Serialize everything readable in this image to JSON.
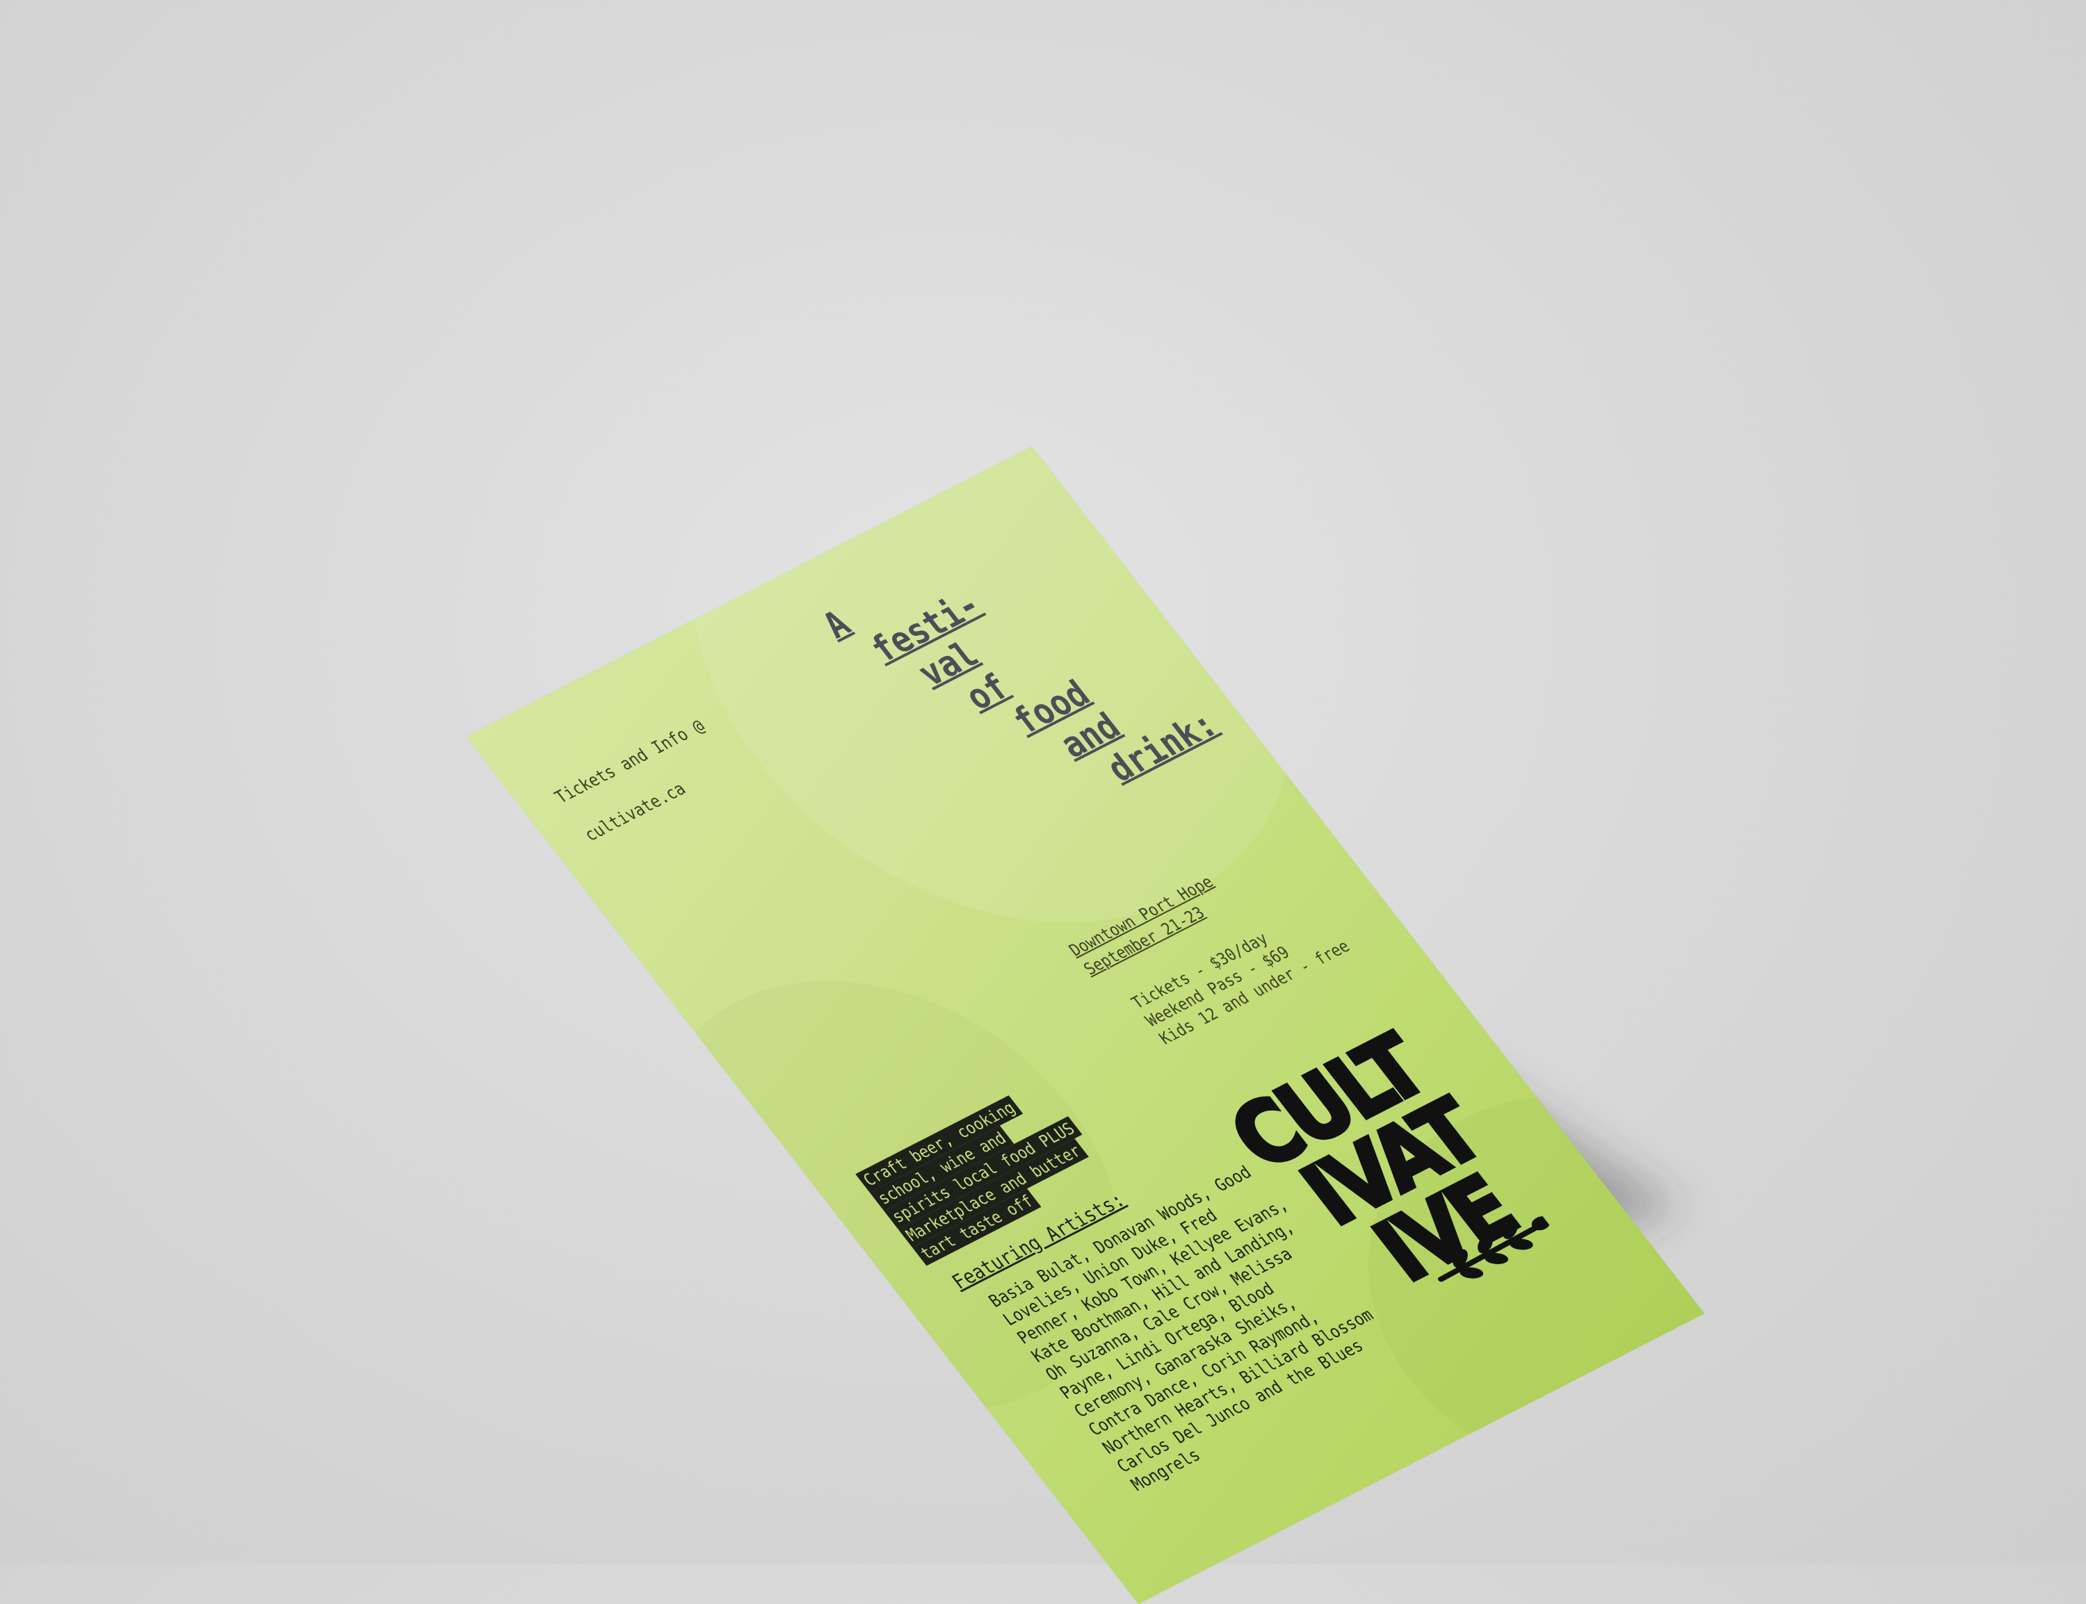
{
  "flyer": {
    "tickets_info_line1": "Tickets and Info @",
    "tickets_info_line2": "cultivate.ca",
    "headline_words": [
      "A",
      "festi-",
      "val",
      "of",
      "food",
      "and",
      "drink:"
    ],
    "location_line1": "Downtown Port Hope",
    "location_line2": "September 21-23",
    "prices_line1": "Tickets - $30/day",
    "prices_line2": "Weekend Pass - $69",
    "prices_line3": "Kids 12 and under - free",
    "highlight_lines": [
      "Craft beer, cooking",
      "school, wine and",
      "spirits local food PLUS",
      "Marketplace and butter",
      "tart taste off"
    ],
    "artists_title": "Featuring Artists:",
    "artists_text": "Basia Bulat, Donavan Woods, Good Lovelies, Union Duke, Fred Penner, Kobo Town, Kellyee Evans, Kate Boothman, Hill and Landing, Oh Suzanna, Cale Crow, Melissa Payne, Lindi Ortega, Blood Ceremony, Ganaraska Sheiks, Contra Dance, Corin Raymond, Northern Hearts, Billiard Blossom Carlos Del Junco and the Blues Mongrels",
    "logo_text": "CULTIVATE",
    "logo_row1": "CULT",
    "logo_row2": "IVAT",
    "logo_row3": "IVE"
  },
  "colors": {
    "background": "#d7d7d7",
    "flyer_green": "#c6df80",
    "ink_dark": "#1e211a",
    "headline_grey": "#4a4f57"
  },
  "icons": {
    "logo_sprig": "sprig-icon"
  }
}
